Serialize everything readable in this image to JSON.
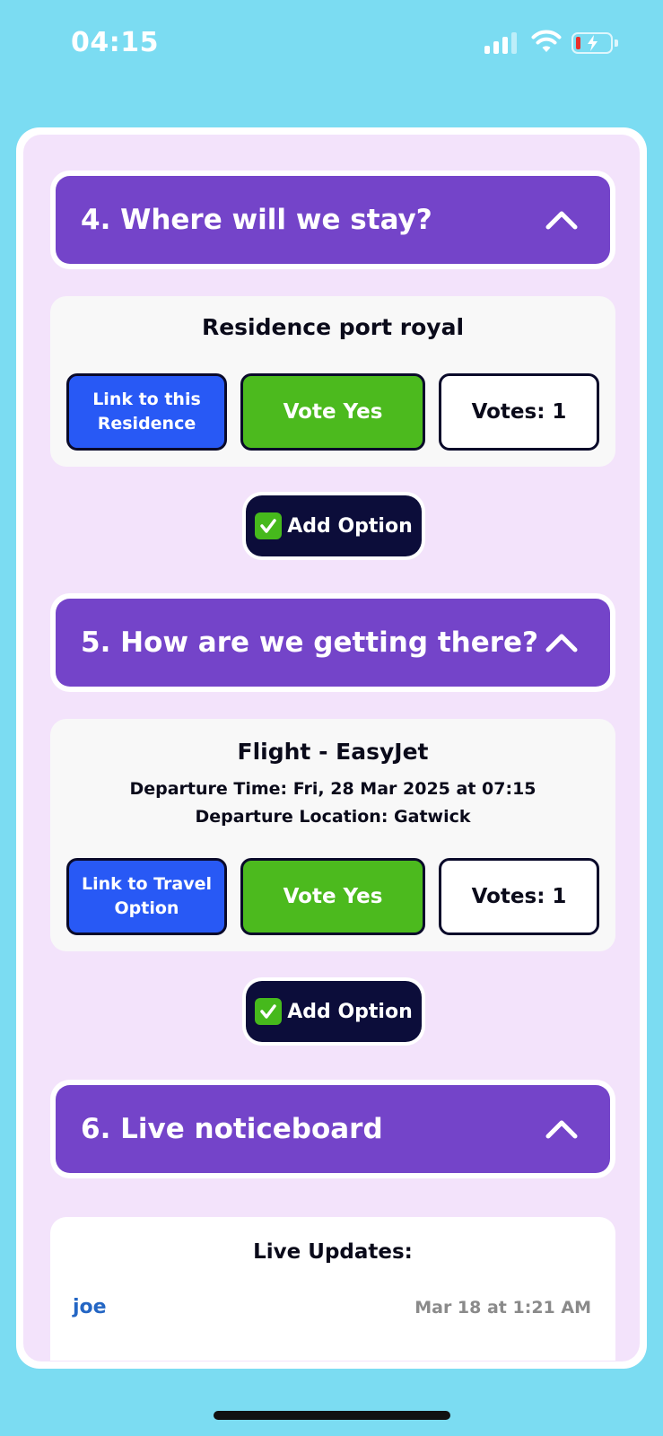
{
  "status_bar": {
    "time": "04:15",
    "battery_level": 0.1,
    "battery_color": "#e8302b",
    "signal_bars_active": 3
  },
  "theme": {
    "background": "#7bdcf2",
    "card_background": "#f3e3fb",
    "header_color": "#7444c9",
    "link_color": "#2859f5",
    "vote_color": "#4cba1e",
    "add_option_color": "#0c0d3a"
  },
  "sections": [
    {
      "title": "4. Where will we stay?",
      "icon": "chevron-up-icon",
      "option": {
        "title": "Residence port royal",
        "link_label": "Link to this Residence",
        "vote_label": "Vote Yes",
        "votes_label": "Votes: 1"
      },
      "add_option": {
        "icon": "check-mark-button-icon",
        "label": "Add Option"
      }
    },
    {
      "title": "5. How are we getting there?",
      "icon": "chevron-up-icon",
      "option": {
        "title": "Flight - EasyJet",
        "departure_time": "Departure Time: Fri, 28 Mar 2025 at 07:15",
        "departure_location": "Departure Location: Gatwick",
        "link_label": "Link to Travel Option",
        "vote_label": "Vote Yes",
        "votes_label": "Votes: 1"
      },
      "add_option": {
        "icon": "check-mark-button-icon",
        "label": "Add Option"
      }
    },
    {
      "title": "6. Live noticeboard",
      "icon": "chevron-up-icon",
      "live": {
        "title": "Live Updates:",
        "messages": [
          {
            "user": "joe",
            "time": "Mar 18 at 1:21 AM"
          }
        ]
      }
    }
  ]
}
